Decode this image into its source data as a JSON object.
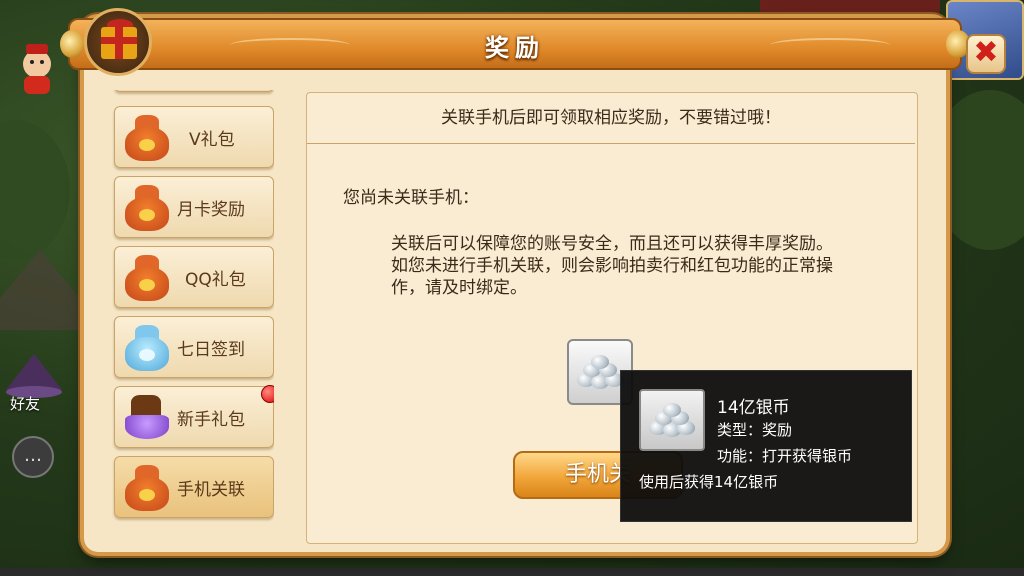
{
  "dialog": {
    "title": "奖励",
    "close_glyph": "✖"
  },
  "nav": {
    "items": [
      {
        "label": "V礼包",
        "icon": "gift-bag-icon"
      },
      {
        "label": "月卡奖励",
        "icon": "gift-bag-icon"
      },
      {
        "label": "QQ礼包",
        "icon": "gift-bag-icon"
      },
      {
        "label": "七日签到",
        "icon": "blue-gift-bag-icon"
      },
      {
        "label": "新手礼包",
        "icon": "purple-treasure-icon",
        "badge": true
      },
      {
        "label": "手机关联",
        "icon": "gift-bag-icon",
        "active": true
      }
    ]
  },
  "content": {
    "banner": "关联手机后即可领取相应奖励，不要错过哦！",
    "status": "您尚未关联手机：",
    "description": "关联后可以保障您的账号安全，而且还可以获得丰厚奖励。如您未进行手机关联，则会影响拍卖行和红包功能的正常操作，请及时绑定。",
    "reward_icon": "silver-coin-pile-icon",
    "bind_button": "手机关"
  },
  "tooltip": {
    "name": "14亿银币",
    "type": "类型：奖励",
    "function": "功能：打开获得银币",
    "use": "使用后获得14亿银币",
    "icon": "silver-coin-pile-icon"
  },
  "hud": {
    "friend_label": "好友"
  },
  "colors": {
    "title_bar": "#e08a2a",
    "panel": "#f6e6c5",
    "badge": "#dd0000",
    "tooltip_bg": "#0c0c0c"
  }
}
